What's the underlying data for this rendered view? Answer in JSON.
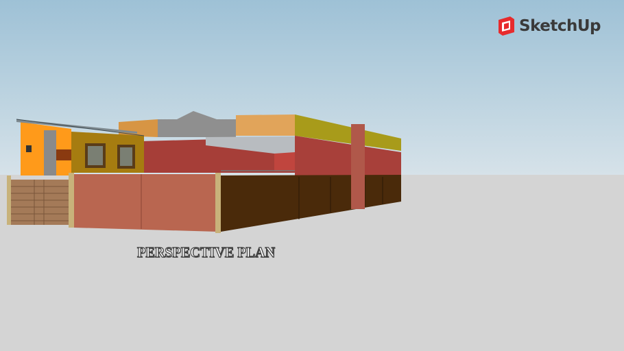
{
  "app": {
    "brand": "SketchUp",
    "brand_color": "#e72b2d"
  },
  "scene": {
    "caption": "PERSPECTIVE PLAN",
    "colors": {
      "sky_top": "#9ec1d6",
      "ground": "#d4d4d4",
      "wall_orange": "#ff9a1a",
      "wall_mustard": "#a67c10",
      "wall_red_brick": "#a8453c",
      "boundary_wall": "#b96650",
      "dark_wall": "#4a2a0a",
      "stone_cladding": "#8a8a8a"
    }
  }
}
